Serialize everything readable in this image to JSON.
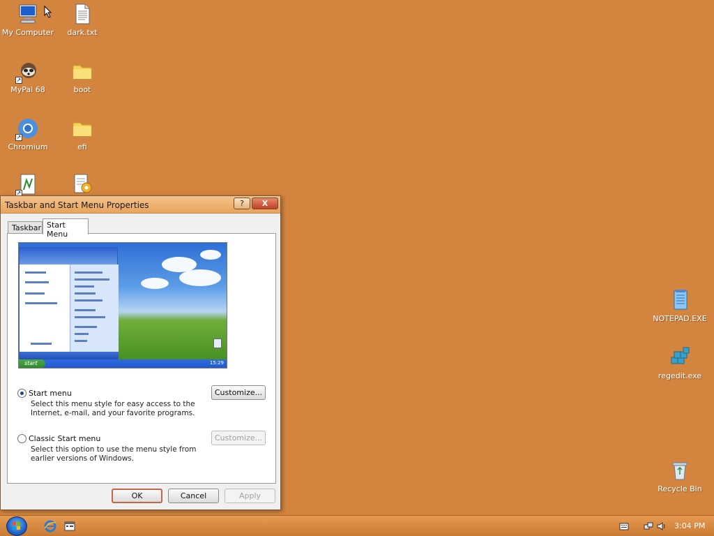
{
  "desktop": {
    "icons": [
      {
        "label": "My Computer",
        "icon": "computer-icon"
      },
      {
        "label": "dark.txt",
        "icon": "text-file-icon"
      },
      {
        "label": "MyPal 68",
        "icon": "mypal-icon"
      },
      {
        "label": "boot",
        "icon": "folder-icon"
      },
      {
        "label": "Chromium",
        "icon": "chromium-icon"
      },
      {
        "label": "efi",
        "icon": "folder-icon"
      },
      {
        "label": "NOTEPAD.EXE",
        "icon": "notepad-icon"
      },
      {
        "label": "regedit.exe",
        "icon": "regedit-icon"
      },
      {
        "label": "Recycle Bin",
        "icon": "recycle-bin-icon"
      }
    ]
  },
  "dialog": {
    "title": "Taskbar and Start Menu Properties",
    "help_label": "?",
    "close_label": "X",
    "tabs": [
      {
        "label": "Taskbar",
        "active": false
      },
      {
        "label": "Start Menu",
        "active": true
      }
    ],
    "preview": {
      "start_label": "start",
      "time_label": "15:29"
    },
    "options": [
      {
        "label": "Start menu",
        "description": "Select this menu style for easy access to the Internet, e-mail, and your favorite programs.",
        "checked": true,
        "customize_label": "Customize...",
        "customize_enabled": true
      },
      {
        "label": "Classic Start menu",
        "description": "Select this option to use the menu style from earlier versions of Windows.",
        "checked": false,
        "customize_label": "Customize...",
        "customize_enabled": false
      }
    ],
    "buttons": {
      "ok": "OK",
      "cancel": "Cancel",
      "apply": "Apply"
    }
  },
  "taskbar": {
    "clock": "3:04 PM",
    "quick_launch": [
      "ie-icon",
      "show-desktop-icon"
    ],
    "tray": [
      "keyboard-icon",
      "network-icon",
      "volume-icon"
    ]
  },
  "colors": {
    "desktop": "#d3843f",
    "taskbar": "#d88a44",
    "title_bar": "#eab072"
  }
}
